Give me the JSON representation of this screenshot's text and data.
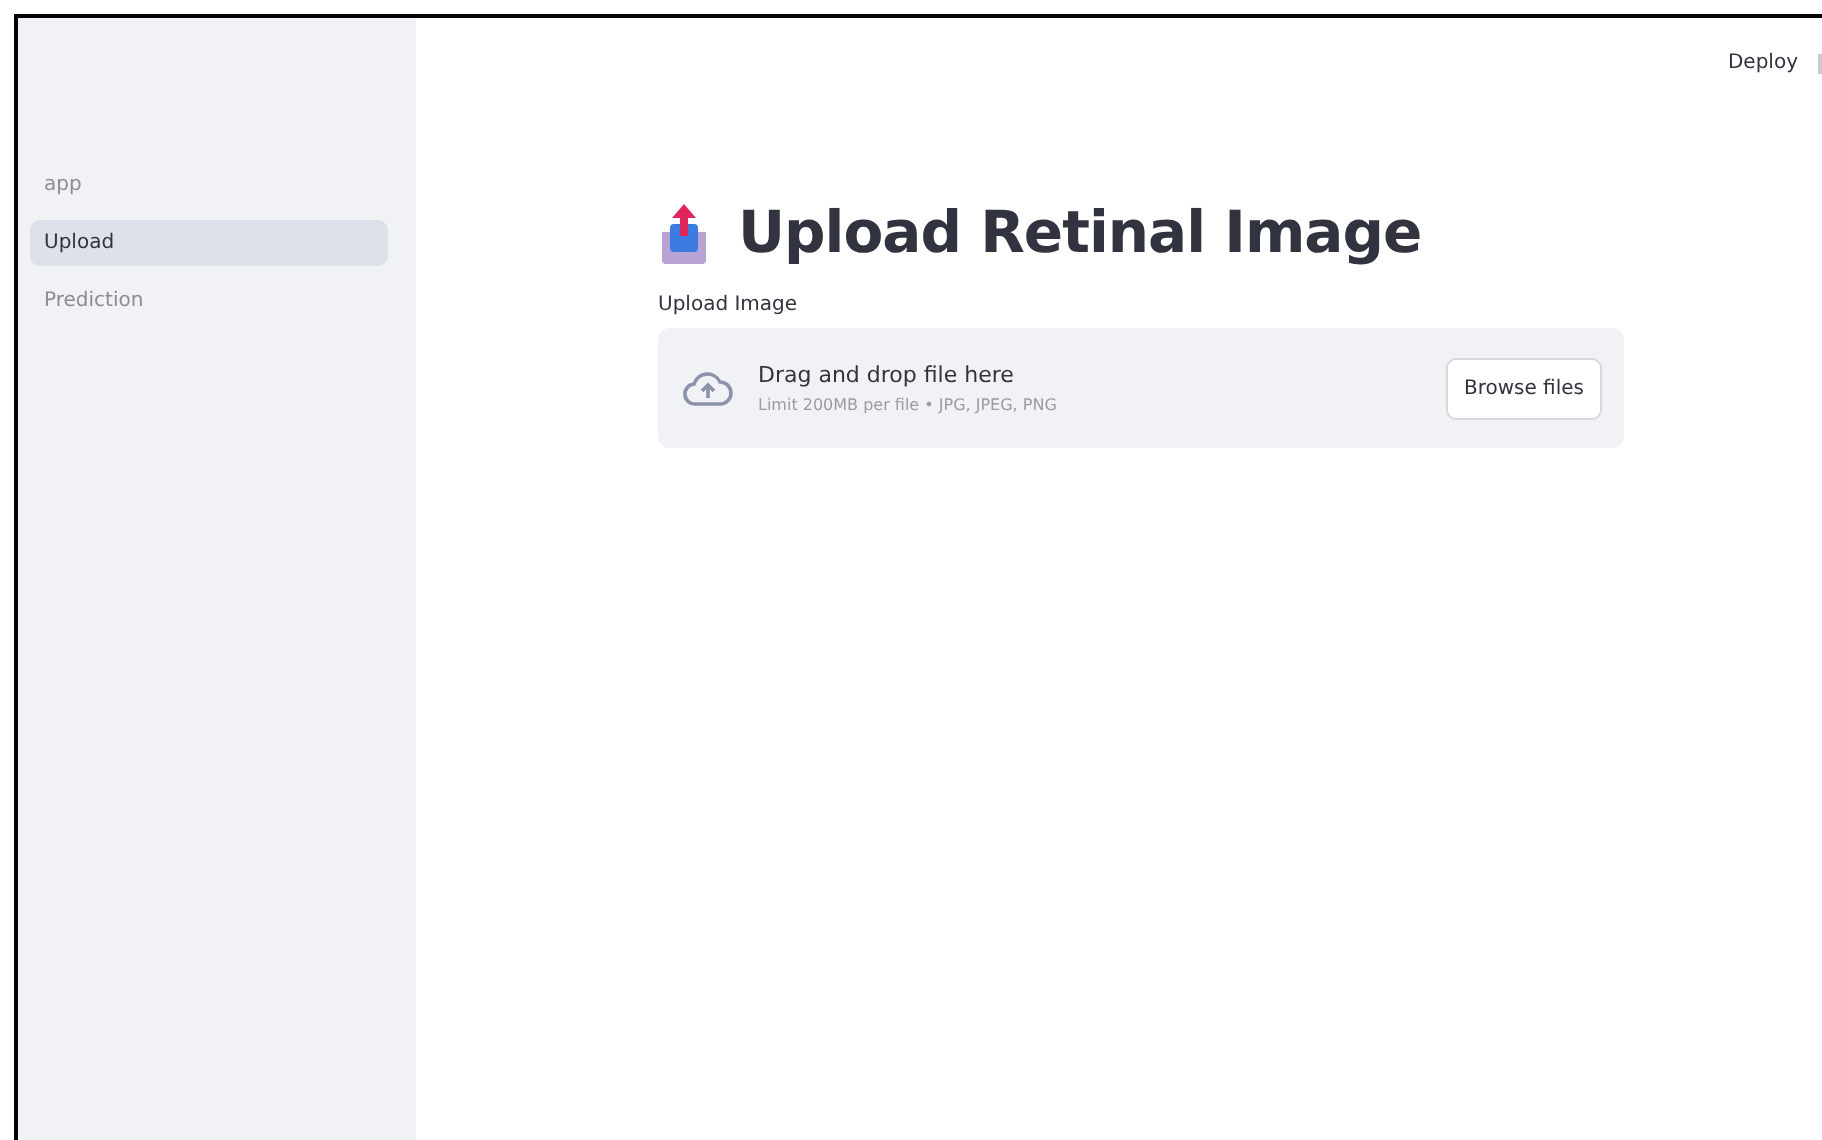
{
  "sidebar": {
    "items": [
      {
        "label": "app",
        "selected": false
      },
      {
        "label": "Upload",
        "selected": true
      },
      {
        "label": "Prediction",
        "selected": false
      }
    ]
  },
  "header": {
    "deploy": "Deploy"
  },
  "title": "Upload Retinal Image",
  "uploader": {
    "label": "Upload Image",
    "instruction": "Drag and drop file here",
    "limit": "Limit 200MB per file • JPG, JPEG, PNG",
    "button": "Browse files"
  }
}
